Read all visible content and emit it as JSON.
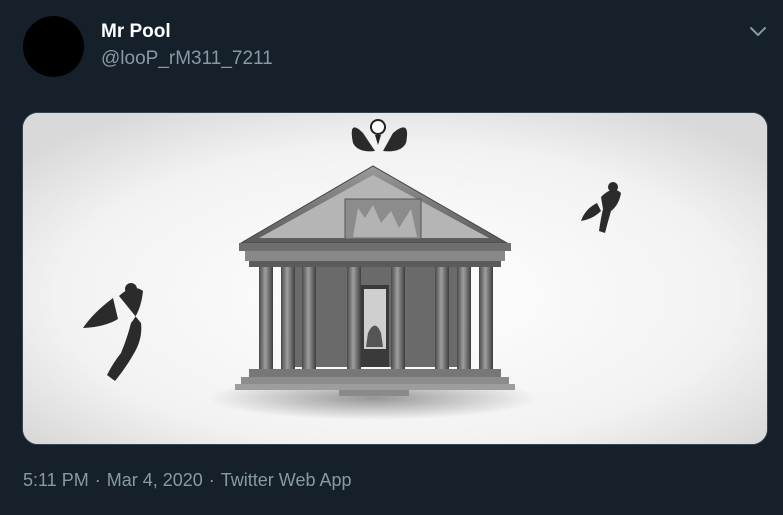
{
  "user": {
    "display_name": "Mr Pool",
    "handle": "@looP_rM311_7211"
  },
  "meta": {
    "time": "5:11 PM",
    "separator_1": "·",
    "date": "Mar 4, 2020",
    "separator_2": "·",
    "source": "Twitter Web App"
  },
  "icons": {
    "caret": "chevron-down-icon"
  },
  "colors": {
    "background": "#15202b",
    "name": "#ffffff",
    "secondary_text": "#8899a6"
  }
}
